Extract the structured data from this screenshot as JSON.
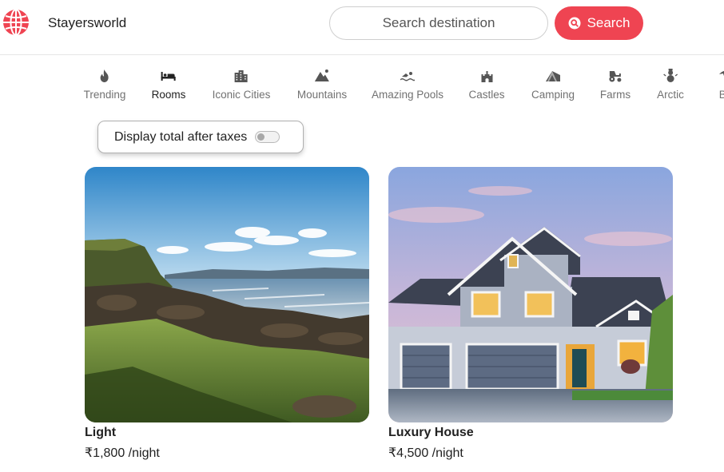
{
  "header": {
    "brand": "Stayersworld",
    "search_placeholder": "Search destination",
    "search_button": "Search"
  },
  "categories": [
    {
      "label": "Trending",
      "icon": "fire-icon",
      "active": false
    },
    {
      "label": "Rooms",
      "icon": "bed-icon",
      "active": true
    },
    {
      "label": "Iconic Cities",
      "icon": "city-icon",
      "active": false
    },
    {
      "label": "Mountains",
      "icon": "mountain-icon",
      "active": false
    },
    {
      "label": "Amazing Pools",
      "icon": "swimmer-icon",
      "active": false
    },
    {
      "label": "Castles",
      "icon": "castle-icon",
      "active": false
    },
    {
      "label": "Camping",
      "icon": "tent-icon",
      "active": false
    },
    {
      "label": "Farms",
      "icon": "tractor-icon",
      "active": false
    },
    {
      "label": "Arctic",
      "icon": "snowman-icon",
      "active": false
    },
    {
      "label": "Be",
      "icon": "umbrella-beach-icon",
      "active": false
    }
  ],
  "tax_toggle": {
    "label": "Display total after taxes",
    "enabled": false
  },
  "listings": [
    {
      "title": "Light",
      "price": "₹1,800 /night",
      "image": "coastal landscape photo"
    },
    {
      "title": "Luxury House",
      "price": "₹4,500 /night",
      "image": "house at dusk photo"
    }
  ],
  "colors": {
    "accent": "#ef4452",
    "text": "#222222",
    "muted": "#717171"
  }
}
